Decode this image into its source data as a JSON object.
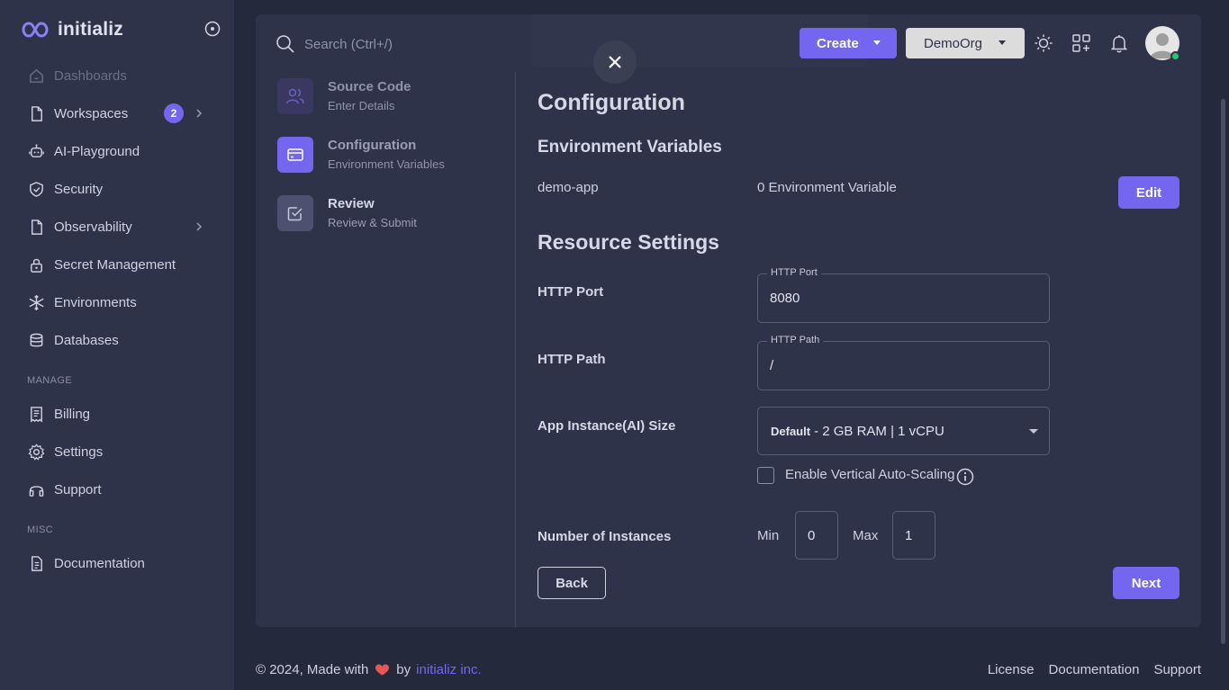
{
  "brand": {
    "name": "initializ"
  },
  "sidebar": {
    "items": [
      {
        "label": "Dashboards",
        "icon": "home-icon",
        "disabled": true
      },
      {
        "label": "Workspaces",
        "icon": "file-icon",
        "badge": "2",
        "chevron": true
      },
      {
        "label": "AI-Playground",
        "icon": "robot-icon"
      },
      {
        "label": "Security",
        "icon": "shield-check-icon"
      },
      {
        "label": "Observability",
        "icon": "file-icon",
        "chevron": true
      },
      {
        "label": "Secret Management",
        "icon": "lock-icon"
      },
      {
        "label": "Environments",
        "icon": "snowflake-icon"
      },
      {
        "label": "Databases",
        "icon": "database-icon"
      }
    ],
    "manage_label": "MANAGE",
    "manage_items": [
      {
        "label": "Billing",
        "icon": "receipt-icon"
      },
      {
        "label": "Settings",
        "icon": "gear-icon"
      },
      {
        "label": "Support",
        "icon": "headphones-icon"
      }
    ],
    "misc_label": "MISC",
    "misc_items": [
      {
        "label": "Documentation",
        "icon": "document-icon"
      }
    ]
  },
  "topbar": {
    "search_placeholder": "Search (Ctrl+/)",
    "create_label": "Create",
    "org_label": "DemoOrg"
  },
  "steps": [
    {
      "title": "Source Code",
      "subtitle": "Enter Details",
      "icon": "users-icon",
      "state": "done"
    },
    {
      "title": "Configuration",
      "subtitle": "Environment Variables",
      "icon": "credit-card-icon",
      "state": "active"
    },
    {
      "title": "Review",
      "subtitle": "Review & Submit",
      "icon": "checkbox-icon",
      "state": "pending"
    }
  ],
  "config": {
    "heading": "Configuration",
    "env_heading": "Environment Variables",
    "app_name": "demo-app",
    "env_count": "0 Environment Variable",
    "edit_label": "Edit",
    "resource_heading": "Resource Settings",
    "http_port_label": "HTTP Port",
    "http_port_legend": "HTTP Port",
    "http_port_value": "8080",
    "http_path_label": "HTTP Path",
    "http_path_legend": "HTTP Path",
    "http_path_value": "/",
    "instance_size_label": "App Instance(AI) Size",
    "instance_size_default": "Default",
    "instance_size_value": "- 2 GB RAM | 1 vCPU",
    "autoscaling_label": "Enable Vertical Auto-Scaling",
    "autoscaling_checked": false,
    "instances_label": "Number of Instances",
    "min_label": "Min",
    "min_value": "0",
    "max_label": "Max",
    "max_value": "1",
    "back_label": "Back",
    "next_label": "Next"
  },
  "footer": {
    "copyright_prefix": "© 2024, Made with",
    "by": "by",
    "company": "initializ inc.",
    "links": [
      "License",
      "Documentation",
      "Support"
    ]
  },
  "colors": {
    "accent": "#7367f0",
    "background": "#25293c",
    "surface": "#2f3349",
    "online": "#28c76f"
  }
}
